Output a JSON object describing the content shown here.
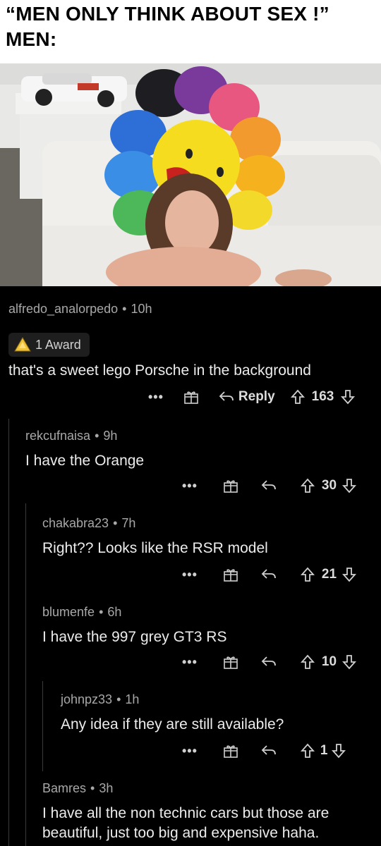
{
  "meme": {
    "line1": "“MEN ONLY THINK ABOUT SEX !”",
    "line2": "MEN:"
  },
  "comments": [
    {
      "user": "alfredo_analorpedo",
      "time": "10h",
      "award": "1 Award",
      "text": "that's a sweet lego Porsche in the background",
      "reply_label": "Reply",
      "votes": "163"
    },
    {
      "user": "rekcufnaisa",
      "time": "9h",
      "text": "I have the Orange",
      "votes": "30"
    },
    {
      "user": "chakabra23",
      "time": "7h",
      "text": "Right?? Looks like the RSR model",
      "votes": "21"
    },
    {
      "user": "blumenfe",
      "time": "6h",
      "text": "I have the 997 grey GT3 RS",
      "votes": "10"
    },
    {
      "user": "johnpz33",
      "time": "1h",
      "text": "Any idea if they are still available?",
      "votes": "1"
    },
    {
      "user": "Bamres",
      "time": "3h",
      "text": "I have all the non technic cars but those are beautiful, just too big and expensive haha."
    }
  ],
  "ui": {
    "more_glyph": "•••",
    "separator": "•"
  },
  "colors": {
    "background": "#000000",
    "text": "#ececec",
    "meta": "#a8a8a8"
  }
}
